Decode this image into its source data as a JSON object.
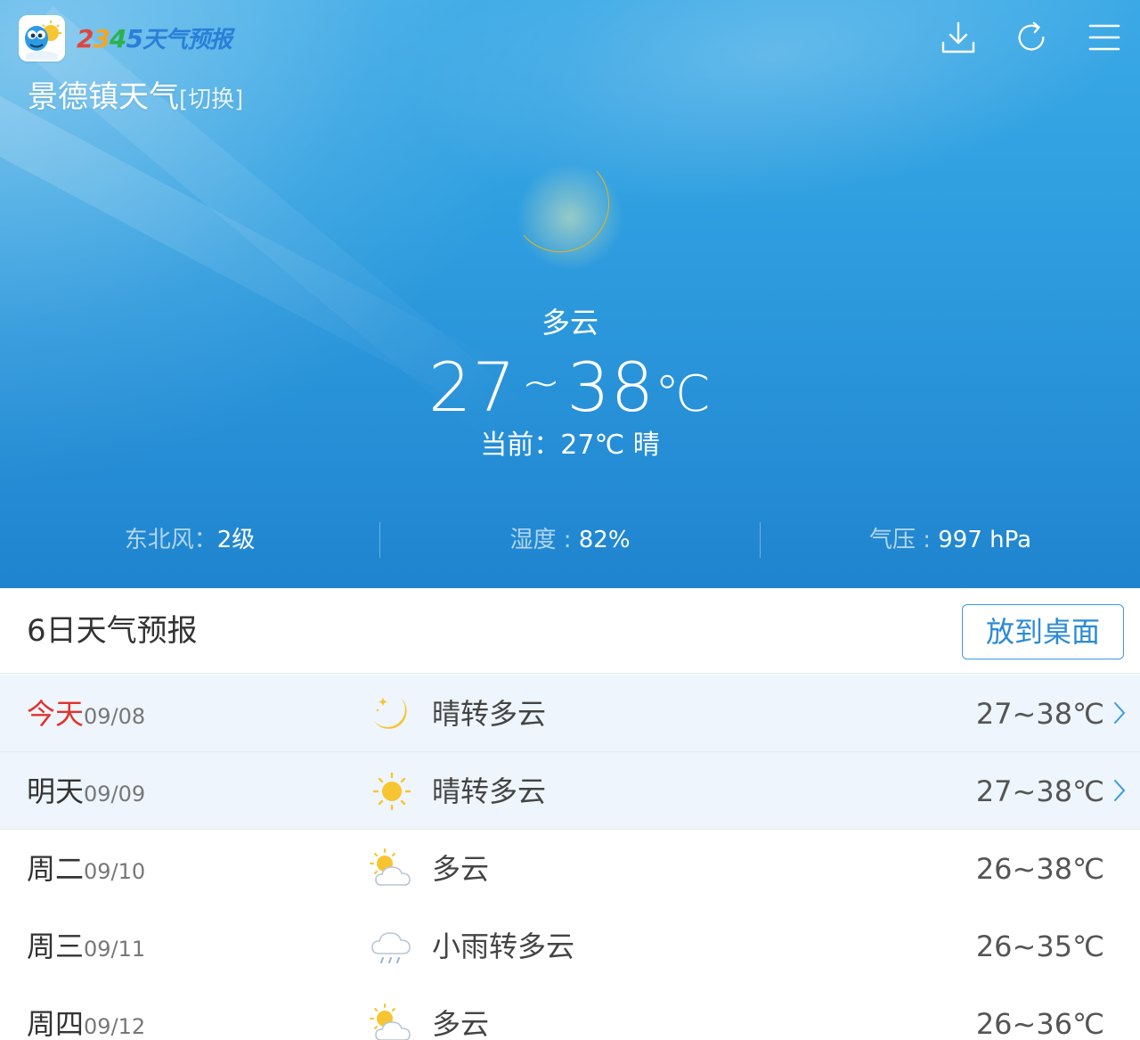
{
  "app": {
    "brand_digits": [
      "2",
      "3",
      "4",
      "5"
    ],
    "brand_text": "天气预报"
  },
  "header": {
    "city": "景德镇天气",
    "switch_label": "[切换]"
  },
  "current": {
    "condition": "多云",
    "temp_low": "27",
    "temp_sep": "~",
    "temp_high": "38",
    "unit": "℃",
    "now_text": "当前：27℃ 晴",
    "icon": "moon-icon"
  },
  "stats": {
    "wind_label": "东北风：",
    "wind_value": "2级",
    "humidity_label": "湿度 : ",
    "humidity_value": "82%",
    "pressure_label": "气压 : ",
    "pressure_value": "997 hPa"
  },
  "forecast": {
    "title": "6日天气预报",
    "pin_button": "放到桌面",
    "days": [
      {
        "day": "今天",
        "date": "09/08",
        "icon": "moon-icon",
        "condition": "晴转多云",
        "temp": "27~38℃",
        "highlight": true,
        "today": true,
        "arrow": true
      },
      {
        "day": "明天",
        "date": "09/09",
        "icon": "sun-icon",
        "condition": "晴转多云",
        "temp": "27~38℃",
        "highlight": true,
        "today": false,
        "arrow": true
      },
      {
        "day": "周二",
        "date": "09/10",
        "icon": "partly-cloudy-icon",
        "condition": "多云",
        "temp": "26~38℃",
        "highlight": false,
        "today": false,
        "arrow": false
      },
      {
        "day": "周三",
        "date": "09/11",
        "icon": "light-rain-icon",
        "condition": "小雨转多云",
        "temp": "26~35℃",
        "highlight": false,
        "today": false,
        "arrow": false
      },
      {
        "day": "周四",
        "date": "09/12",
        "icon": "partly-cloudy-icon",
        "condition": "多云",
        "temp": "26~36℃",
        "highlight": false,
        "today": false,
        "arrow": false
      }
    ]
  },
  "colors": {
    "sky_top": "#3ba9e6",
    "sky_bottom": "#1f84cf",
    "today_red": "#e0322b",
    "accent_blue": "#2a8bd8",
    "highlight_row": "#eef5fc"
  }
}
